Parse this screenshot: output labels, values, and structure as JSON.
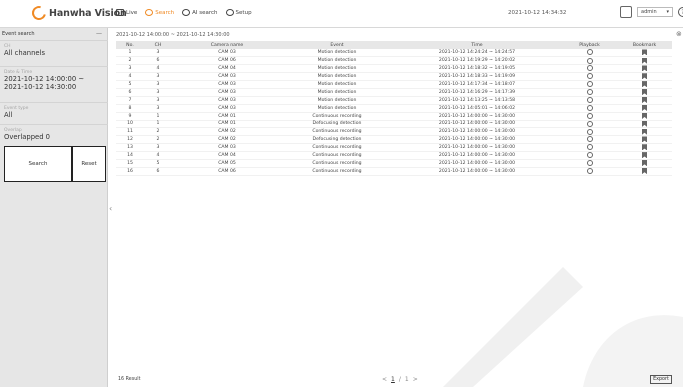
{
  "header": {
    "brand": "Hanwha Vision",
    "tabs": [
      {
        "label": "Live",
        "icon": "monitor-icon"
      },
      {
        "label": "Search",
        "icon": "search-icon"
      },
      {
        "label": "AI search",
        "icon": "ai-search-icon"
      },
      {
        "label": "Setup",
        "icon": "gear-icon"
      }
    ],
    "active_tab": "Search",
    "datetime": "2021-10-12 14:34:32",
    "user": "admin",
    "help": "?"
  },
  "sidebar": {
    "title": "Event search",
    "collapse": "—",
    "fields": [
      {
        "label": "CH",
        "value": "All channels"
      },
      {
        "label": "Date & Time",
        "value": "2021-10-12 14:00:00 ~\n2021-10-12 14:30:00"
      },
      {
        "label": "Event type",
        "value": "All"
      },
      {
        "label": "Overlap",
        "value": "Overlapped 0"
      }
    ],
    "search_label": "Search",
    "reset_label": "Reset"
  },
  "main": {
    "range": "2021-10-12 14:00:00 ~ 2021-10-12 14:30:00",
    "close": "⊗",
    "columns": [
      "No.",
      "CH",
      "Camera name",
      "Event",
      "Time",
      "Playback",
      "Bookmark"
    ],
    "rows": [
      [
        "1",
        "3",
        "CAM 03",
        "Motion detection",
        "2021-10-12 14:24:24 ~ 14:24:57"
      ],
      [
        "2",
        "6",
        "CAM 06",
        "Motion detection",
        "2021-10-12 14:19:29 ~ 14:20:02"
      ],
      [
        "3",
        "4",
        "CAM 04",
        "Motion detection",
        "2021-10-12 14:18:32 ~ 14:19:05"
      ],
      [
        "4",
        "3",
        "CAM 03",
        "Motion detection",
        "2021-10-12 14:18:33 ~ 14:19:09"
      ],
      [
        "5",
        "3",
        "CAM 03",
        "Motion detection",
        "2021-10-12 14:17:34 ~ 14:18:07"
      ],
      [
        "6",
        "3",
        "CAM 03",
        "Motion detection",
        "2021-10-12 14:16:29 ~ 14:17:39"
      ],
      [
        "7",
        "3",
        "CAM 03",
        "Motion detection",
        "2021-10-12 14:13:25 ~ 14:13:58"
      ],
      [
        "8",
        "3",
        "CAM 03",
        "Motion detection",
        "2021-10-12 14:05:01 ~ 14:06:02"
      ],
      [
        "9",
        "1",
        "CAM 01",
        "Continuous recording",
        "2021-10-12 14:00:00 ~ 14:30:00"
      ],
      [
        "10",
        "1",
        "CAM 01",
        "Defocusing detection",
        "2021-10-12 14:00:00 ~ 14:30:00"
      ],
      [
        "11",
        "2",
        "CAM 02",
        "Continuous recording",
        "2021-10-12 14:00:00 ~ 14:30:00"
      ],
      [
        "12",
        "2",
        "CAM 02",
        "Defocusing detection",
        "2021-10-12 14:00:00 ~ 14:30:00"
      ],
      [
        "13",
        "3",
        "CAM 03",
        "Continuous recording",
        "2021-10-12 14:00:00 ~ 14:30:00"
      ],
      [
        "14",
        "4",
        "CAM 04",
        "Continuous recording",
        "2021-10-12 14:00:00 ~ 14:30:00"
      ],
      [
        "15",
        "5",
        "CAM 05",
        "Continuous recording",
        "2021-10-12 14:00:00 ~ 14:30:00"
      ],
      [
        "16",
        "6",
        "CAM 06",
        "Continuous recording",
        "2021-10-12 14:00:00 ~ 14:30:00"
      ]
    ]
  },
  "footer": {
    "results": "16 Result",
    "prev": "<",
    "page": "1",
    "page_sep": "/",
    "total": "1",
    "next": ">",
    "export_label": "Export"
  },
  "colors": {
    "accent": "#f08a24",
    "sidebar_bg": "#e6e6e6",
    "header_row": "#e7e7e7"
  }
}
